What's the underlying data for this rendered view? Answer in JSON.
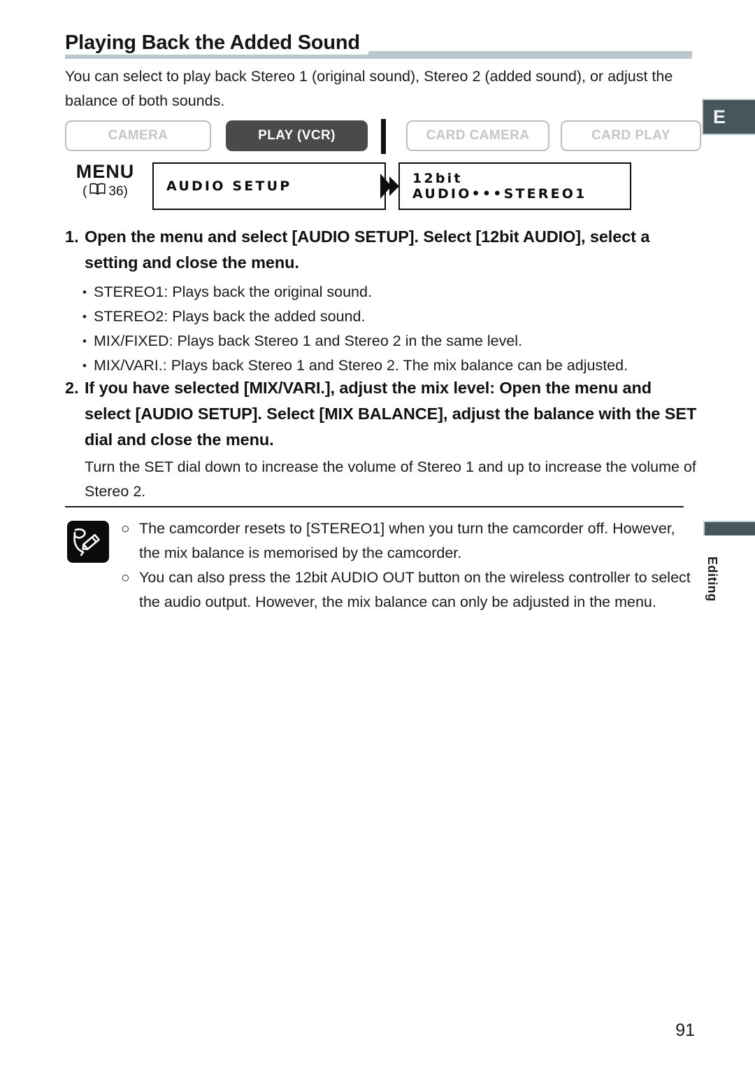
{
  "page": {
    "title": "Playing Back the Added Sound",
    "intro": "You can select to play back Stereo 1 (original sound), Stereo 2 (added sound), or adjust the balance of both sounds.",
    "page_number": "91",
    "chapter_letter": "E",
    "section_label": "Editing",
    "title_rule_color": "#b9c8cb",
    "tab_color": "#47555c"
  },
  "modes": {
    "items": [
      {
        "label": "CAMERA",
        "state": "inactive"
      },
      {
        "label": "PLAY (VCR)",
        "state": "active"
      },
      {
        "label": "CARD CAMERA",
        "state": "inactive"
      },
      {
        "label": "CARD PLAY",
        "state": "inactive"
      }
    ]
  },
  "menu_flow": {
    "menu_word": "MENU",
    "ref_open": "(",
    "ref_page": "36)",
    "box_1": "AUDIO SETUP",
    "box_2": "12bit AUDIO•••STEREO1"
  },
  "steps": [
    {
      "number": "1.",
      "text": "Open the menu and select [AUDIO SETUP]. Select [12bit AUDIO], select a setting and close the menu."
    },
    {
      "number": "2.",
      "text": "If you have selected [MIX/VARI.], adjust the mix level: Open the menu and select [AUDIO SETUP]. Select [MIX BALANCE], adjust the balance with the SET dial and close the menu."
    }
  ],
  "bullets": [
    "STEREO1: Plays back the original sound.",
    "STEREO2: Plays back the added sound.",
    "MIX/FIXED: Plays back Stereo 1 and Stereo 2 in the same level.",
    "MIX/VARI.: Plays back Stereo 1 and Stereo 2. The mix balance can be adjusted."
  ],
  "substep": "Turn the SET dial down to increase the volume of Stereo 1 and up to increase the volume of Stereo 2.",
  "notes": {
    "marker": "○",
    "items": [
      "The camcorder resets to [STEREO1] when you turn the camcorder off. However, the mix balance is memorised by the camcorder.",
      "You can also press the 12bit AUDIO OUT button on the wireless controller to select the audio output. However, the mix balance can only be adjusted in the menu."
    ]
  }
}
